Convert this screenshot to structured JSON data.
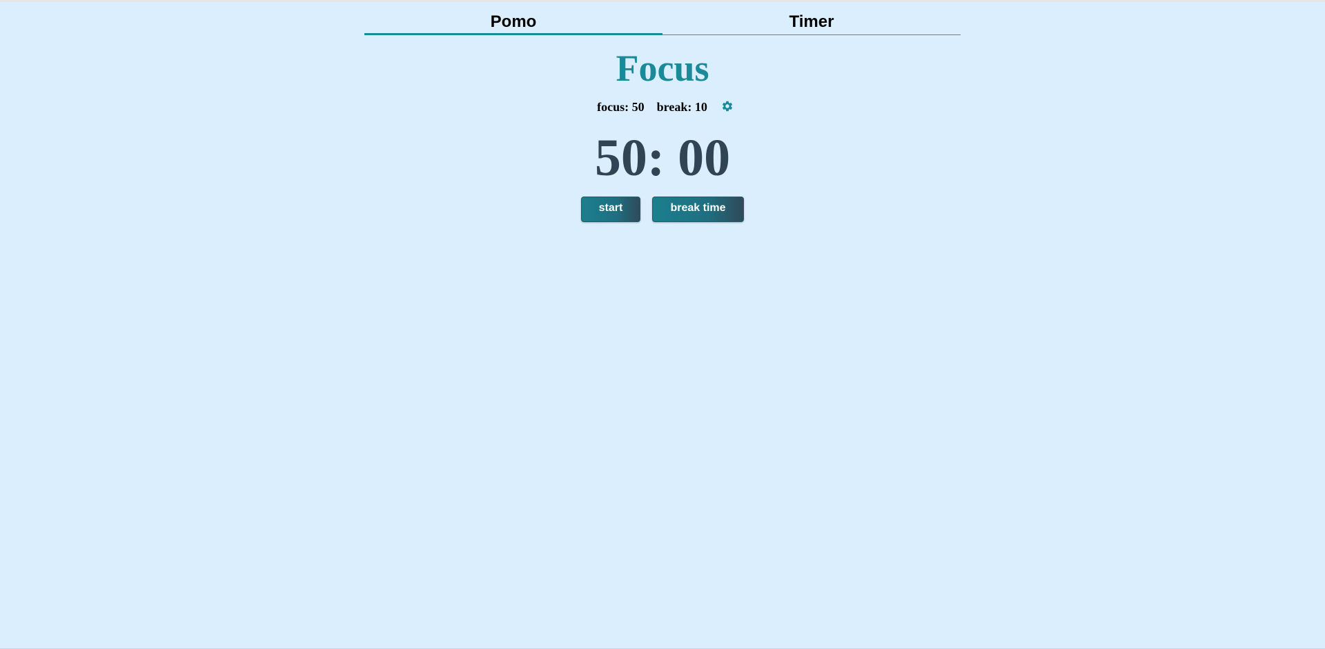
{
  "tabs": [
    {
      "label": "Pomo",
      "active": true
    },
    {
      "label": "Timer",
      "active": false
    }
  ],
  "mode_title": "Focus",
  "settings": {
    "focus_label": "focus: 50",
    "break_label": "break: 10",
    "settings_icon": "gear-icon"
  },
  "clock": {
    "display": "50: 00"
  },
  "actions": {
    "start_label": "start",
    "break_label": "break time"
  },
  "colors": {
    "background": "#dbeefd",
    "accent": "#1a8a99",
    "clock_text": "#2f4454",
    "button_start": "#1b7f8e",
    "button_end": "#2f4a5a"
  }
}
